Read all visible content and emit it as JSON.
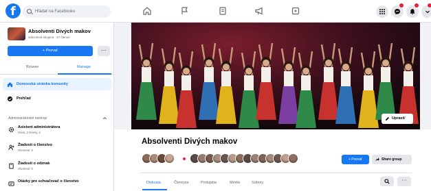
{
  "topbar": {
    "logo": "f",
    "search_placeholder": "Hľadať na Facebooku",
    "nav_icons": [
      "home-icon",
      "flag-icon",
      "pages-icon",
      "megaphone-icon",
      "marketplace-icon"
    ],
    "right_icons": [
      "grid-icon",
      "messenger-icon",
      "bell-icon",
      "account-chevron-icon"
    ]
  },
  "sidebar": {
    "group_name": "Absolventi Divých makov",
    "group_meta": "Súkromná skupina · 27 členov",
    "invite_label": "+ Pozvať",
    "more_label": "···",
    "tabs": [
      {
        "label": "Browse"
      },
      {
        "label": "Manage"
      }
    ],
    "items": [
      {
        "label": "Domovská stránka komunity",
        "icon": "home-icon"
      },
      {
        "label": "Prehľad",
        "icon": "overview-icon"
      }
    ],
    "section_title": "Administrátorské nástroje",
    "admin_items": [
      {
        "title": "Asistent administrátora",
        "subtitle": "včera, 2 zmeny, 2",
        "icon": "gear-icon"
      },
      {
        "title": "Žiadosti o členstvo",
        "subtitle": "Otvorené: 0",
        "icon": "add-person-icon"
      },
      {
        "title": "Žiadosti o odznak",
        "subtitle": "Otvorené: 0",
        "icon": "badge-icon"
      },
      {
        "title": "Otázky pre schvaľovač o členstvo",
        "subtitle": "",
        "icon": "questions-icon"
      }
    ]
  },
  "main": {
    "title": "Absolventi Divých makov",
    "edit_label": "Upraviť",
    "join_label": "+ Pozvať",
    "share_label": "Share group",
    "tabs": [
      "Diskusia",
      "Členovia",
      "Podujatia",
      "Médiá",
      "Súbory"
    ],
    "more_label": "···"
  },
  "colors": {
    "accent": "#1877f2",
    "badge": "#e41e3f",
    "bg": "#f0f2f5"
  }
}
